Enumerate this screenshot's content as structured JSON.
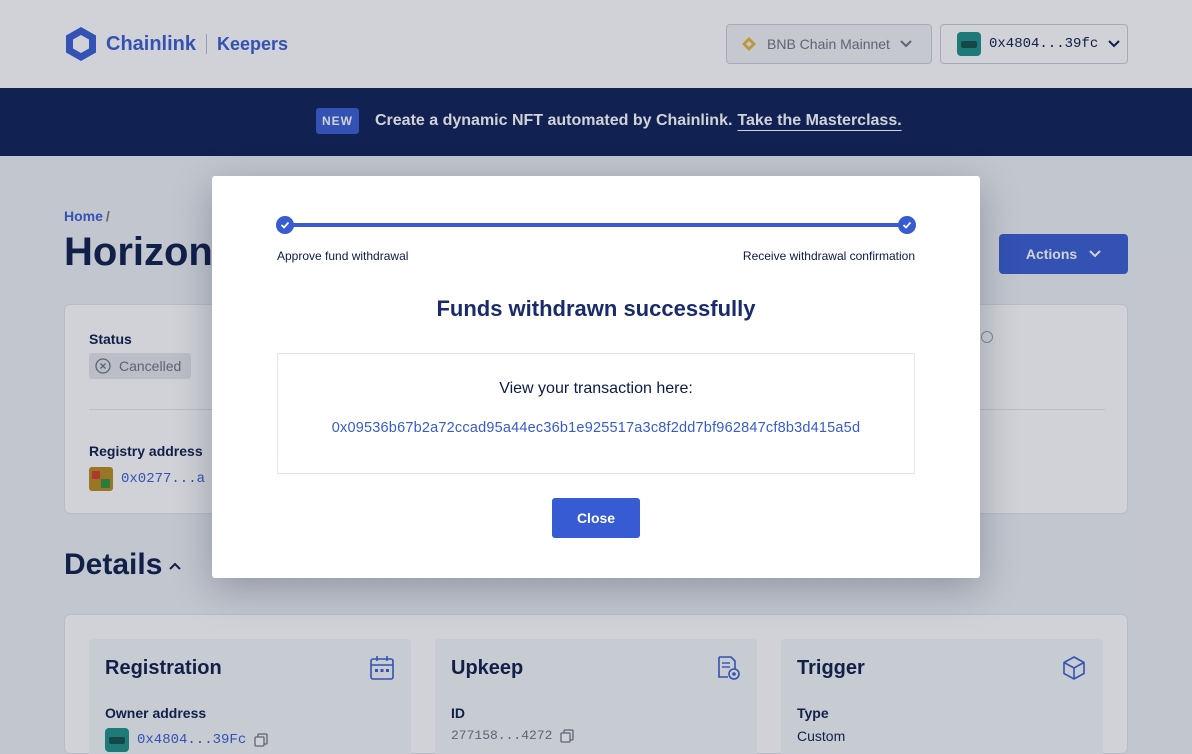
{
  "header": {
    "brand_name": "Chainlink",
    "brand_product": "Keepers",
    "network": "BNB Chain Mainnet",
    "wallet_address": "0x4804...39fc"
  },
  "banner": {
    "badge": "NEW",
    "text": "Create a dynamic NFT automated by Chainlink.",
    "link": "Take the Masterclass."
  },
  "breadcrumb": {
    "home": "Home",
    "separator": "/"
  },
  "page": {
    "title": "Horizon",
    "actions_label": "Actions"
  },
  "status_card": {
    "status_label": "Status",
    "status_value": "Cancelled",
    "registry_label": "Registry address",
    "registry_value": "0x0277...a"
  },
  "details": {
    "title": "Details",
    "registration": {
      "title": "Registration",
      "field_label": "Owner address",
      "field_value": "0x4804...39Fc"
    },
    "upkeep": {
      "title": "Upkeep",
      "field_label": "ID",
      "field_value": "277158...4272"
    },
    "trigger": {
      "title": "Trigger",
      "field_label": "Type",
      "field_value": "Custom"
    }
  },
  "modal": {
    "step1_label": "Approve fund withdrawal",
    "step2_label": "Receive withdrawal confirmation",
    "title": "Funds withdrawn successfully",
    "tx_label": "View your transaction here:",
    "tx_hash": "0x09536b67b2a72ccad95a44ec36b1e925517a3c8f2dd7bf962847cf8b3d415a5d",
    "close_label": "Close"
  },
  "colors": {
    "accent": "#375bd2",
    "banner_bg": "#0b1d55",
    "title_text": "#0b1b4a"
  }
}
